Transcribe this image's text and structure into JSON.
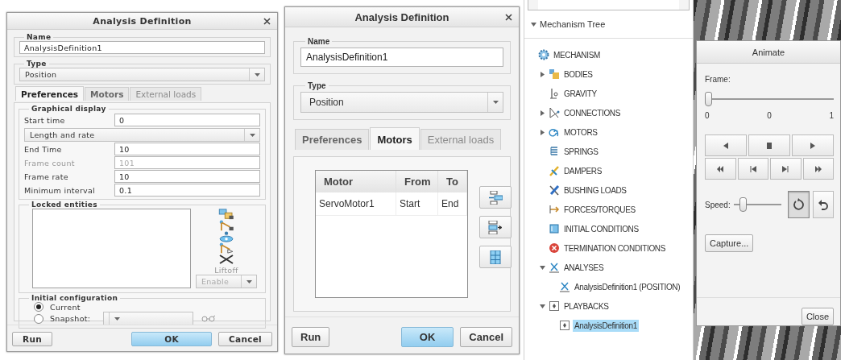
{
  "dialogs": [
    {
      "title": "Analysis Definition",
      "name_label": "Name",
      "name_value": "AnalysisDefinition1",
      "type_label": "Type",
      "type_value": "Position",
      "tabs": [
        {
          "label": "Preferences",
          "selected": true,
          "disabled": false
        },
        {
          "label": "Motors",
          "selected": false,
          "disabled": false
        },
        {
          "label": "External loads",
          "selected": false,
          "disabled": true
        }
      ],
      "panel": {
        "kind": "preferences",
        "graphical_display": {
          "title": "Graphical display",
          "fields": [
            {
              "kind": "field",
              "label": "Start time",
              "value": "0",
              "disabled": false
            },
            {
              "kind": "dropdown",
              "value": "Length and rate"
            },
            {
              "kind": "field",
              "label": "End Time",
              "value": "10",
              "disabled": false
            },
            {
              "kind": "field",
              "label": "Frame count",
              "value": "101",
              "disabled": true
            },
            {
              "kind": "field",
              "label": "Frame rate",
              "value": "10",
              "disabled": false
            },
            {
              "kind": "field",
              "label": "Minimum interval",
              "value": "0.1",
              "disabled": false
            }
          ]
        },
        "locked_entities": {
          "title": "Locked entities",
          "liftoff": {
            "label": "Liftoff",
            "disabled": true
          },
          "enable_dropdown": {
            "value": "Enable",
            "disabled": true
          }
        },
        "initial_configuration": {
          "title": "Initial configuration",
          "options": [
            {
              "kind": "plain",
              "label": "Current",
              "selected": true
            },
            {
              "kind": "snapshot",
              "label": "Snapshot:",
              "selected": false
            }
          ]
        }
      },
      "buttons": [
        {
          "label": "Run",
          "kind": "default"
        },
        {
          "label": "OK",
          "kind": "primary"
        },
        {
          "label": "Cancel",
          "kind": "default"
        }
      ]
    },
    {
      "title": "Analysis Definition",
      "name_label": "Name",
      "name_value": "AnalysisDefinition1",
      "type_label": "Type",
      "type_value": "Position",
      "tabs": [
        {
          "label": "Preferences",
          "selected": false,
          "disabled": false
        },
        {
          "label": "Motors",
          "selected": true,
          "disabled": false
        },
        {
          "label": "External loads",
          "selected": false,
          "disabled": true
        }
      ],
      "panel": {
        "kind": "motors",
        "columns": [
          "Motor",
          "From",
          "To"
        ],
        "rows": [
          [
            "ServoMotor1",
            "Start",
            "End"
          ]
        ]
      },
      "buttons": [
        {
          "label": "Run",
          "kind": "default"
        },
        {
          "label": "OK",
          "kind": "primary"
        },
        {
          "label": "Cancel",
          "kind": "default"
        }
      ]
    }
  ],
  "mechanism_tree": {
    "title": "Mechanism Tree",
    "expanded": true,
    "items": [
      {
        "kind": "mechanism",
        "label": "MECHANISM",
        "selected": false,
        "children": [
          {
            "kind": "bodies",
            "label": "BODIES",
            "selected": false,
            "expanded": false
          },
          {
            "kind": "gravity",
            "label": "GRAVITY",
            "selected": false
          },
          {
            "kind": "connections",
            "label": "CONNECTIONS",
            "selected": false,
            "expanded": false
          },
          {
            "kind": "motors",
            "label": "MOTORS",
            "selected": false,
            "expanded": false
          },
          {
            "kind": "springs",
            "label": "SPRINGS",
            "selected": false
          },
          {
            "kind": "dampers",
            "label": "DAMPERS",
            "selected": false
          },
          {
            "kind": "bushing",
            "label": "BUSHING LOADS",
            "selected": false
          },
          {
            "kind": "forces",
            "label": "FORCES/TORQUES",
            "selected": false
          },
          {
            "kind": "initial",
            "label": "INITIAL CONDITIONS",
            "selected": false
          },
          {
            "kind": "termination",
            "label": "TERMINATION CONDITIONS",
            "selected": false
          },
          {
            "kind": "analyses",
            "label": "ANALYSES",
            "selected": false,
            "expanded": true,
            "children": [
              {
                "kind": "analysis",
                "label": "AnalysisDefinition1 (POSITION)",
                "selected": false
              }
            ]
          },
          {
            "kind": "playbacks",
            "label": "PLAYBACKS",
            "selected": false,
            "expanded": true,
            "children": [
              {
                "kind": "playback",
                "label": "AnalysisDefinition1",
                "selected": true
              }
            ]
          }
        ]
      }
    ]
  },
  "animate": {
    "title": "Animate",
    "frame_label": "Frame:",
    "frame_slider": {
      "level": 0
    },
    "frame_ticks": [
      "0",
      "0",
      "1"
    ],
    "speed_label": "Speed:",
    "speed_slider": {
      "level": 0.15
    },
    "repeat_modes": [
      {
        "kind": "loop",
        "selected": true
      },
      {
        "kind": "reverse",
        "selected": false
      }
    ],
    "capture_button": "Capture...",
    "close_button": "Close"
  }
}
